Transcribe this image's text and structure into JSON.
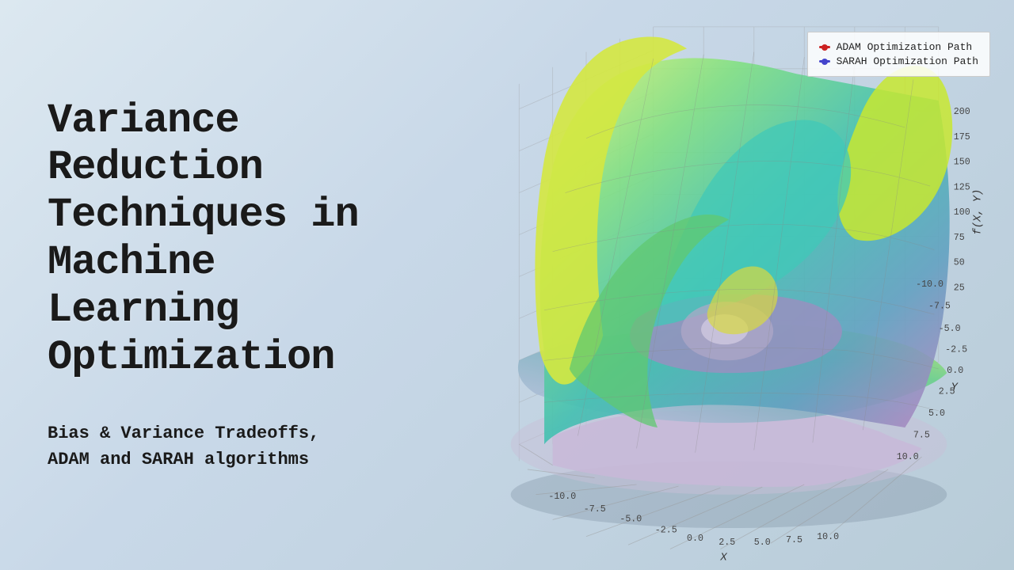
{
  "title": {
    "line1": "Variance",
    "line2": "Reduction",
    "line3": "Techniques in",
    "line4": "Machine",
    "line5": "Learning",
    "line6": "Optimization",
    "full": "Variance\nReduction\nTechniques in\nMachine\nLearning\nOptimization"
  },
  "subtitle": {
    "line1": "Bias & Variance Tradeoffs,",
    "line2": "ADAM and SARAH algorithms"
  },
  "legend": {
    "adam_label": "ADAM Optimization Path",
    "sarah_label": "SARAH Optimization Path",
    "adam_color": "#cc2222",
    "sarah_color": "#4444cc"
  },
  "chart": {
    "x_axis_label": "X",
    "y_axis_label": "Y",
    "z_axis_label": "f(X, Y)",
    "x_ticks": [
      "-10.0",
      "-7.5",
      "-5.0",
      "-2.5",
      "0.0",
      "2.5",
      "5.0",
      "7.5",
      "10.0"
    ],
    "y_ticks": [
      "-10.0",
      "-7.5",
      "-5.0",
      "-2.5",
      "0.0",
      "2.5",
      "5.0",
      "7.5",
      "10.0"
    ],
    "z_ticks": [
      "25",
      "50",
      "75",
      "100",
      "125",
      "150",
      "175",
      "200"
    ]
  },
  "background": {
    "gradient_start": "#dce8f0",
    "gradient_end": "#b8ccd8"
  }
}
